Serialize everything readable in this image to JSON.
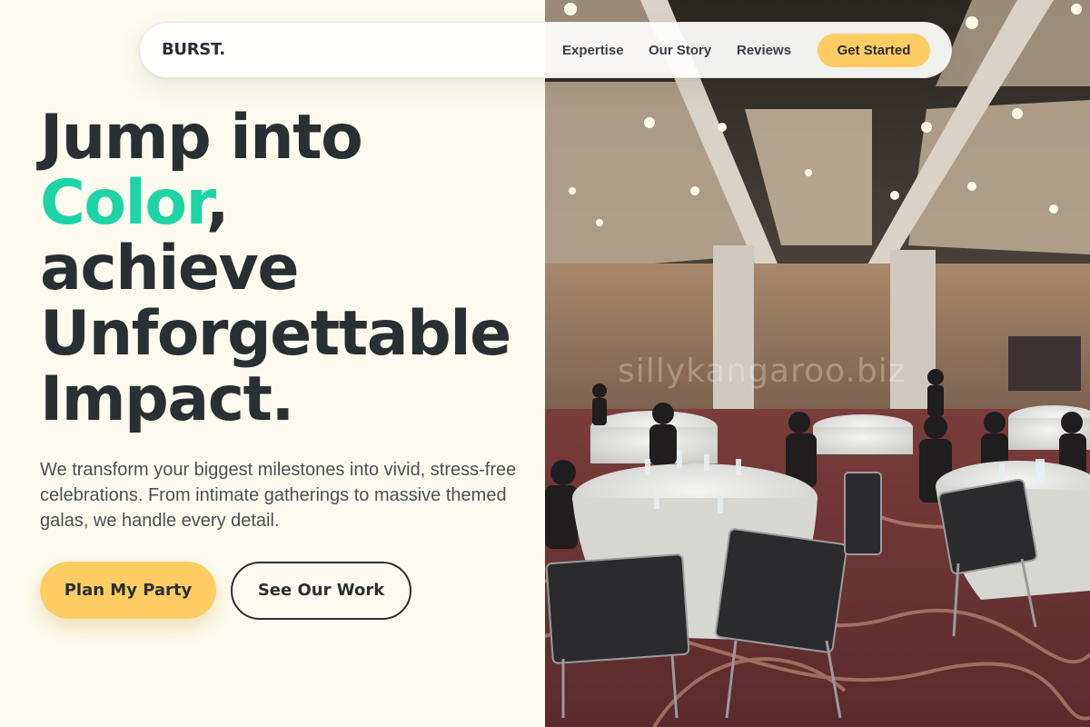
{
  "brand": {
    "logo": "BURST."
  },
  "nav": {
    "links": [
      {
        "label": "Expertise"
      },
      {
        "label": "Our Story"
      },
      {
        "label": "Reviews"
      }
    ],
    "cta_label": "Get Started"
  },
  "hero": {
    "title_line1": "Jump into",
    "title_accent": "Color",
    "title_comma": ",",
    "title_line3": "achieve",
    "title_line4": "Unforgettable",
    "title_line5": "Impact.",
    "description": "We transform your biggest milestones into vivid, stress-free celebrations. From intimate gatherings to massive themed galas, we handle every detail.",
    "primary_button": "Plan My Party",
    "secondary_button": "See Our Work"
  },
  "photo": {
    "subject": "banquet-hall-photo",
    "watermark": "sillykangaroo.biz"
  },
  "colors": {
    "background": "#fdfbf0",
    "accent_green": "#1dd4a5",
    "accent_yellow": "#fdcd63",
    "text_dark": "#2a2f33"
  }
}
